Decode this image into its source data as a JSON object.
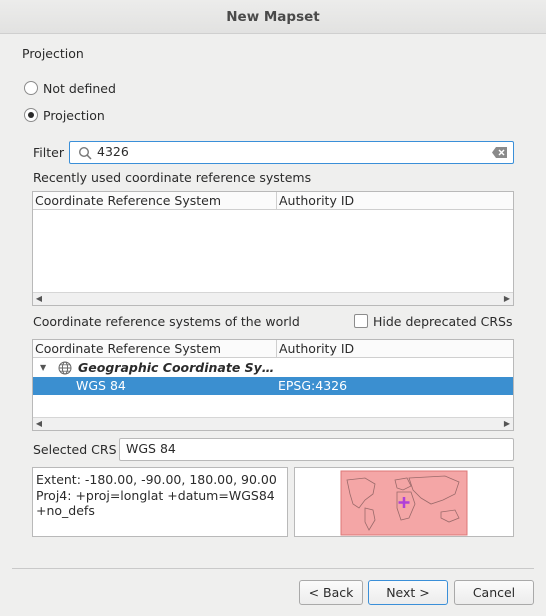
{
  "window": {
    "title": "New Mapset"
  },
  "projection_group": {
    "title": "Projection"
  },
  "options": {
    "not_defined": "Not defined",
    "projection": "Projection",
    "selected": "projection"
  },
  "filter": {
    "label": "Filter",
    "value": "4326"
  },
  "recent": {
    "title": "Recently used coordinate reference systems",
    "columns": [
      "Coordinate Reference System",
      "Authority ID"
    ]
  },
  "world": {
    "title": "Coordinate reference systems of the world",
    "hide_deprecated": "Hide deprecated CRSs",
    "hide_deprecated_checked": false,
    "columns": [
      "Coordinate Reference System",
      "Authority ID"
    ],
    "group": "Geographic Coordinate Sy…",
    "rows": [
      {
        "name": "WGS 84",
        "authority": "EPSG:4326"
      }
    ]
  },
  "selected_crs": {
    "label": "Selected CRS",
    "value": "WGS 84"
  },
  "info": {
    "extent": "Extent: -180.00, -90.00, 180.00, 90.00",
    "proj4_line1": "Proj4: +proj=longlat +datum=WGS84",
    "proj4_line2": "+no_defs"
  },
  "buttons": {
    "back": "< Back",
    "next": "Next >",
    "cancel": "Cancel"
  },
  "colors": {
    "accent": "#3b8fd0",
    "extent_fill": "#f4a6a6",
    "marker": "#b040d8"
  }
}
